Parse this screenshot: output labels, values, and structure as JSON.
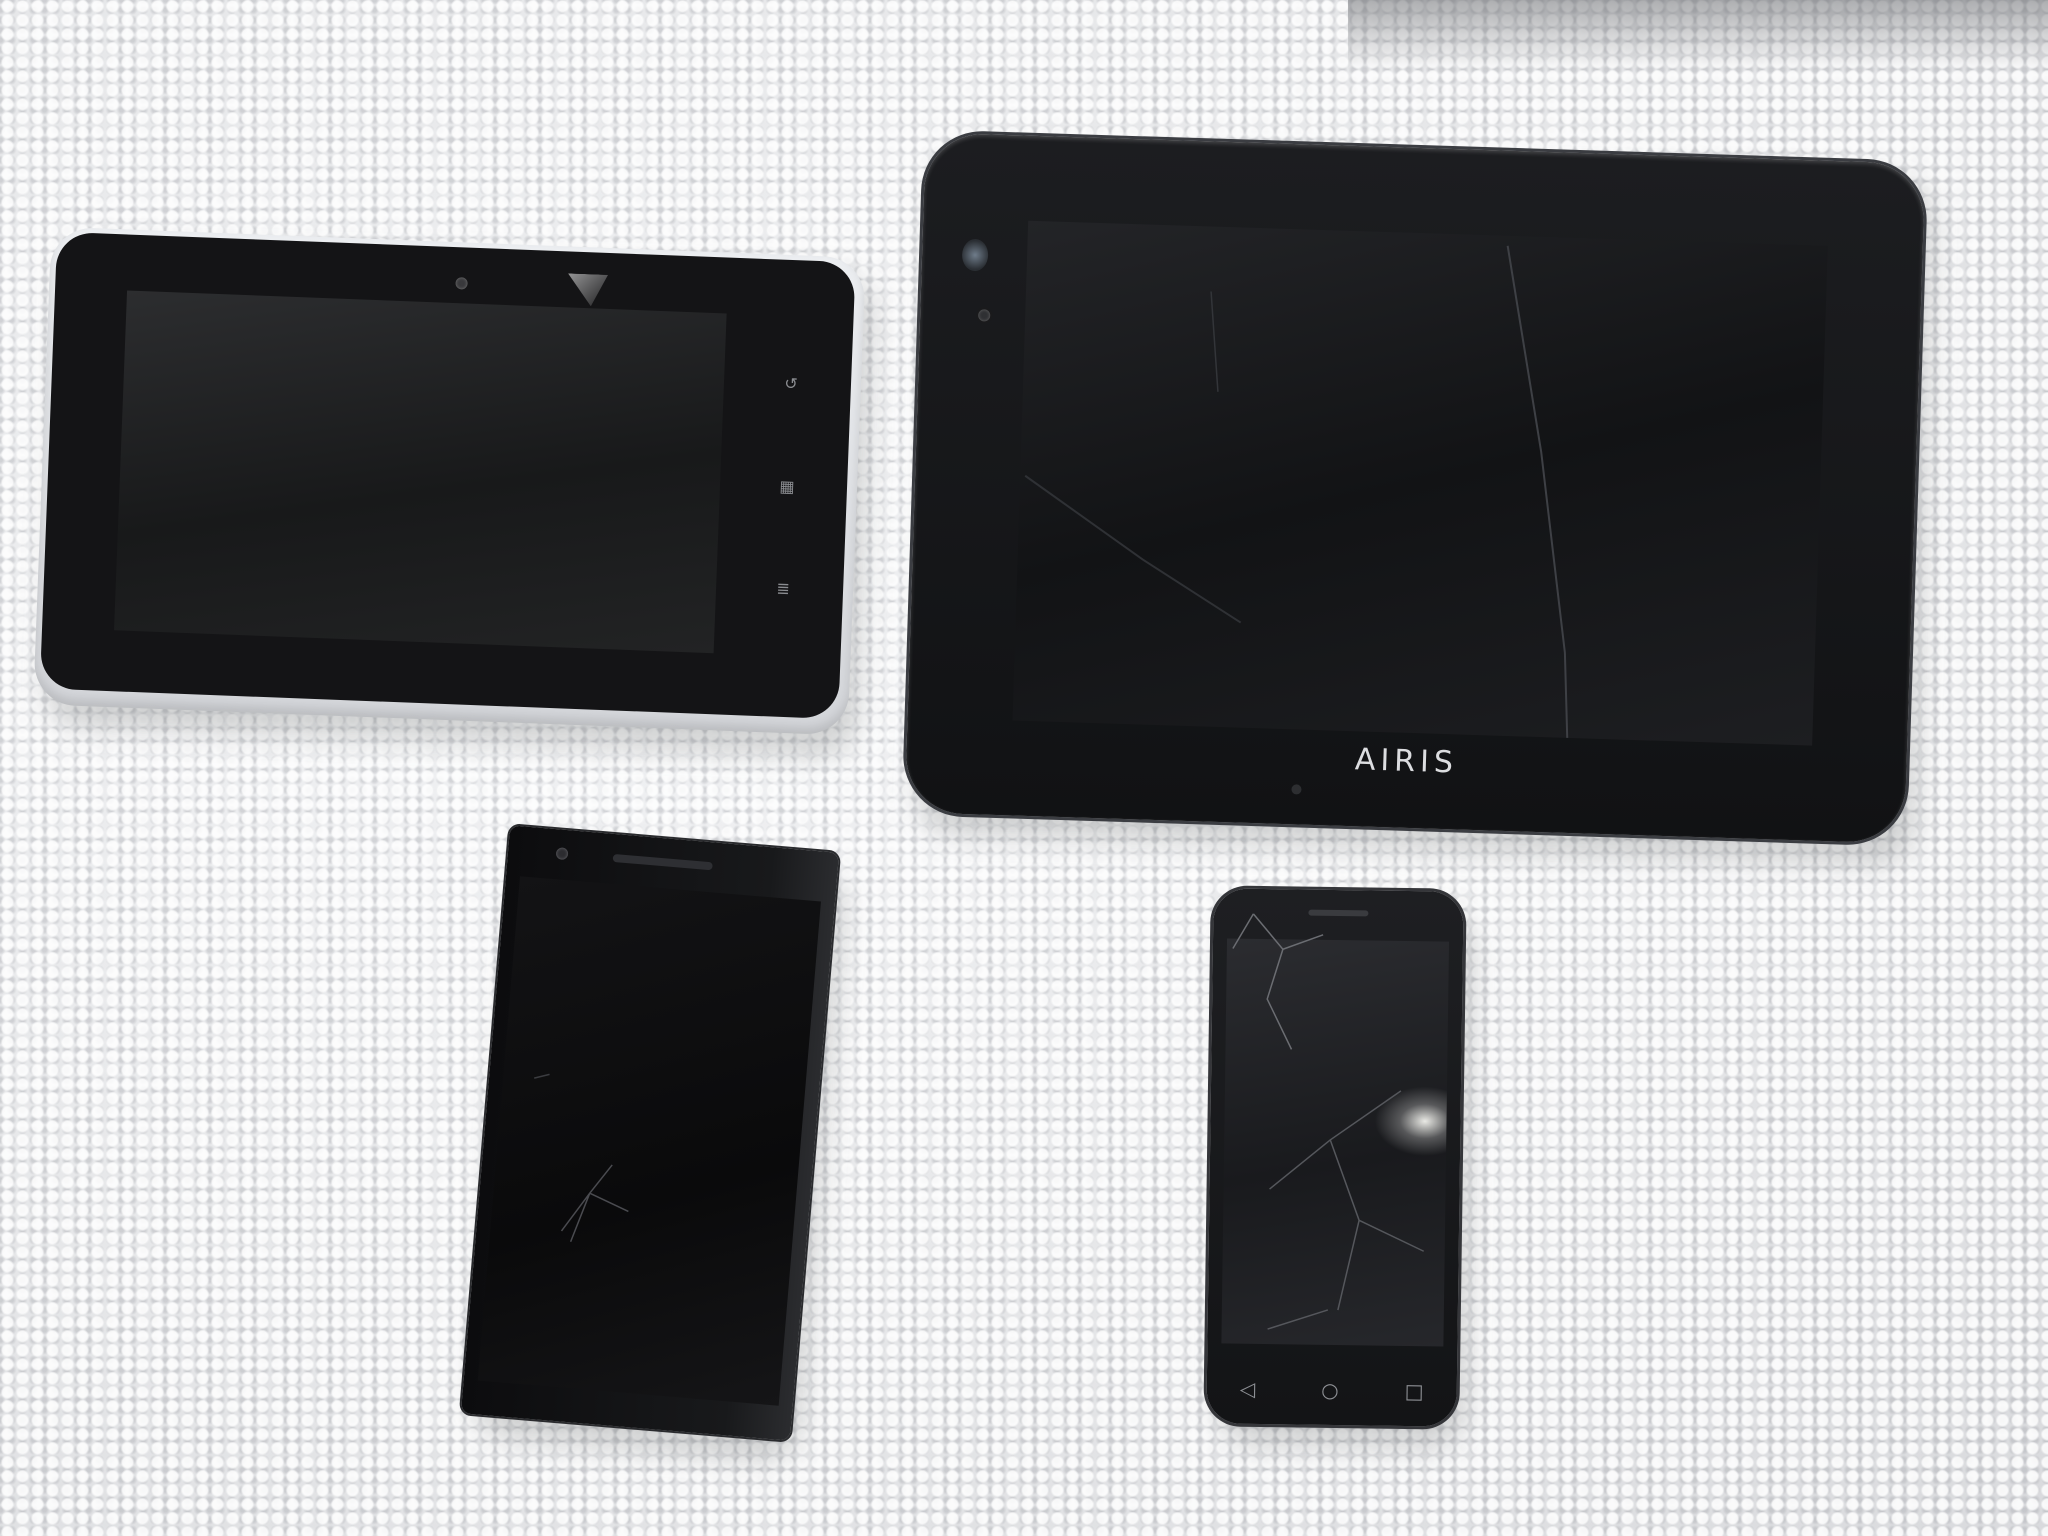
{
  "scene": {
    "background": "#e9eaec",
    "surface": "styrofoam"
  },
  "tablet_left": {
    "frame_color": "#e4e6e9",
    "bezel_color": "#141416",
    "softkeys": [
      "back-icon",
      "home-icon",
      "menu-icon"
    ]
  },
  "tablet_right": {
    "frame_color": "#18191c",
    "brand_text": "AIRIS"
  },
  "phone_left": {
    "frame_color": "#111214"
  },
  "phone_right": {
    "frame_color": "#1a1b1e",
    "nav_buttons": [
      "back-icon",
      "home-icon",
      "recents-icon"
    ]
  }
}
